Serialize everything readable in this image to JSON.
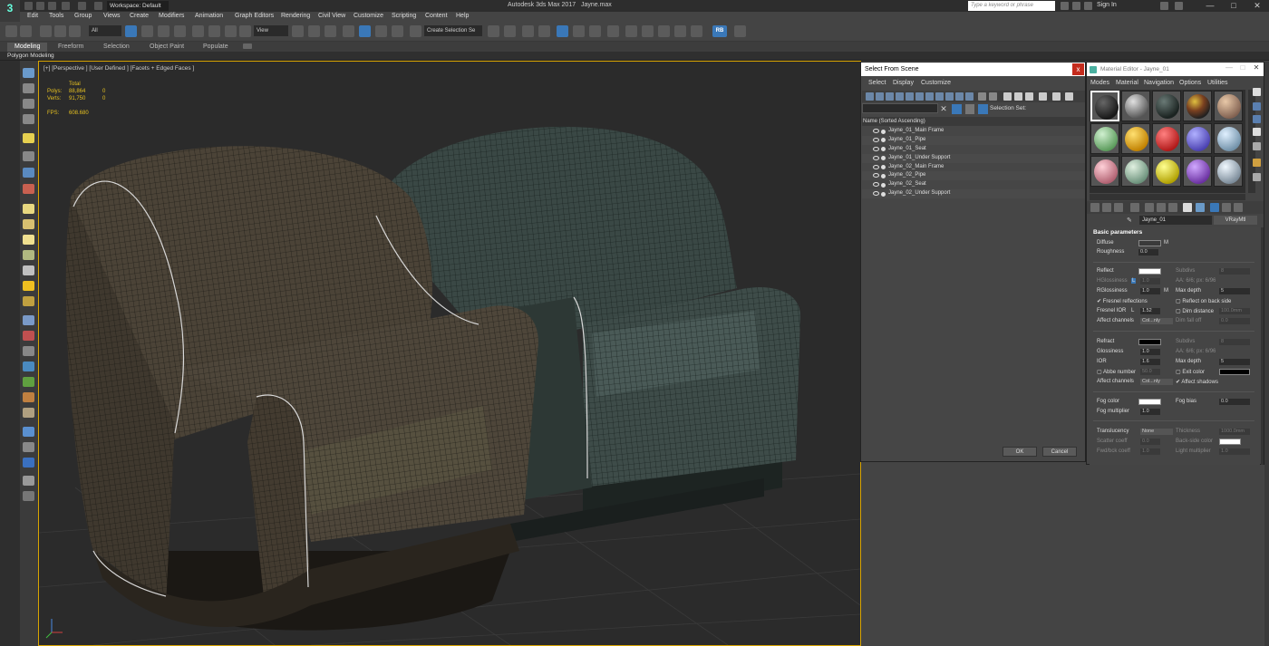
{
  "app": {
    "logo": "3",
    "title": "Autodesk 3ds Max 2017",
    "file": "Jayne.max",
    "workspace": "Workspace: Default",
    "search_placeholder": "Type a keyword or phrase",
    "sign_in": "Sign In"
  },
  "menus": [
    "Edit",
    "Tools",
    "Group",
    "Views",
    "Create",
    "Modifiers",
    "Animation",
    "Graph Editors",
    "Rendering",
    "Civil View",
    "Customize",
    "Scripting",
    "Content",
    "Help"
  ],
  "toolbar": {
    "filter": "All",
    "ref_coord": "View",
    "selection_set": "Create Selection Se",
    "render_badge": "RB"
  },
  "ribbon": {
    "tabs": [
      "Modeling",
      "Freeform",
      "Selection",
      "Object Paint",
      "Populate"
    ],
    "active": "Modeling",
    "sub": "Polygon Modeling"
  },
  "viewport": {
    "label": "[+] [Perspective ] [User Defined ] [Facets + Edged Faces ]",
    "stats": {
      "total_label": "Total",
      "polys_label": "Polys:",
      "polys": "88,864",
      "polys_sel": "0",
      "verts_label": "Verts:",
      "verts": "91,750",
      "verts_sel": "0",
      "fps_label": "FPS:",
      "fps": "608.680"
    }
  },
  "select_from_scene": {
    "title": "Select From Scene",
    "close": "x",
    "menus": [
      "Select",
      "Display",
      "Customize"
    ],
    "selection_set_label": "Selection Set:",
    "column": "Name (Sorted Ascending)",
    "items": [
      "Jayne_01_Main Frame",
      "Jayne_01_Pipe",
      "Jayne_01_Seat",
      "Jayne_01_Under Support",
      "Jayne_02_Main Frame",
      "Jayne_02_Pipe",
      "Jayne_02_Seat",
      "Jayne_02_Under Support"
    ],
    "ok": "OK",
    "cancel": "Cancel"
  },
  "material_editor": {
    "title": "Material Editor - Jayne_01",
    "menus": [
      "Modes",
      "Material",
      "Navigation",
      "Options",
      "Utilities"
    ],
    "mat_name": "Jayne_01",
    "mat_type": "VRayMtl",
    "basic": {
      "header": "Basic parameters",
      "diffuse": "Diffuse",
      "diffuse_m": "M",
      "roughness": "Roughness",
      "roughness_v": "0.0",
      "reflect": "Reflect",
      "subdivs": "Subdivs",
      "subdivs_v": "8",
      "hgloss": "HGlossiness",
      "hgloss_l": "L",
      "hgloss_v": "1.0",
      "aa": "AA: 6/6; px: 6/96",
      "rgloss": "RGlossiness",
      "rgloss_v": "1.0",
      "rgloss_m": "M",
      "maxdepth": "Max depth",
      "maxdepth_v": "5",
      "fresnel": "Fresnel reflections",
      "backside": "Reflect on back side",
      "fresnel_ior": "Fresnel IOR",
      "fresnel_l": "L",
      "fresnel_ior_v": "1.52",
      "dimdist": "Dim distance",
      "dimdist_v": "100.0mm",
      "affect": "Affect channels",
      "affect_v": "Col...nly",
      "dimfall": "Dim fall off",
      "dimfall_v": "0.0",
      "refract": "Refract",
      "r_subdivs": "Subdivs",
      "r_subdivs_v": "8",
      "glossiness": "Glossiness",
      "glossiness_v": "1.0",
      "r_aa": "AA: 6/6; px: 6/96",
      "ior": "IOR",
      "ior_v": "1.6",
      "r_maxdepth": "Max depth",
      "r_maxdepth_v": "5",
      "abbe": "Abbe number",
      "abbe_v": "50.0",
      "exitcolor": "Exit color",
      "r_affect": "Affect channels",
      "r_affect_v": "Col...nly",
      "affect_shadows": "Affect shadows",
      "fogcolor": "Fog color",
      "fogbias": "Fog bias",
      "fogbias_v": "0.0",
      "fogmult": "Fog multiplier",
      "fogmult_v": "1.0",
      "translucency": "Translucency",
      "translucency_v": "None",
      "thickness": "Thickness",
      "thickness_v": "1000.0mm",
      "scatter": "Scatter coeff",
      "scatter_v": "0.0",
      "backside_color": "Back-side color",
      "fwdbck": "Fwd/bck coeff",
      "fwdbck_v": "1.0",
      "lightmult": "Light multiplier",
      "lightmult_v": "1.0"
    }
  }
}
